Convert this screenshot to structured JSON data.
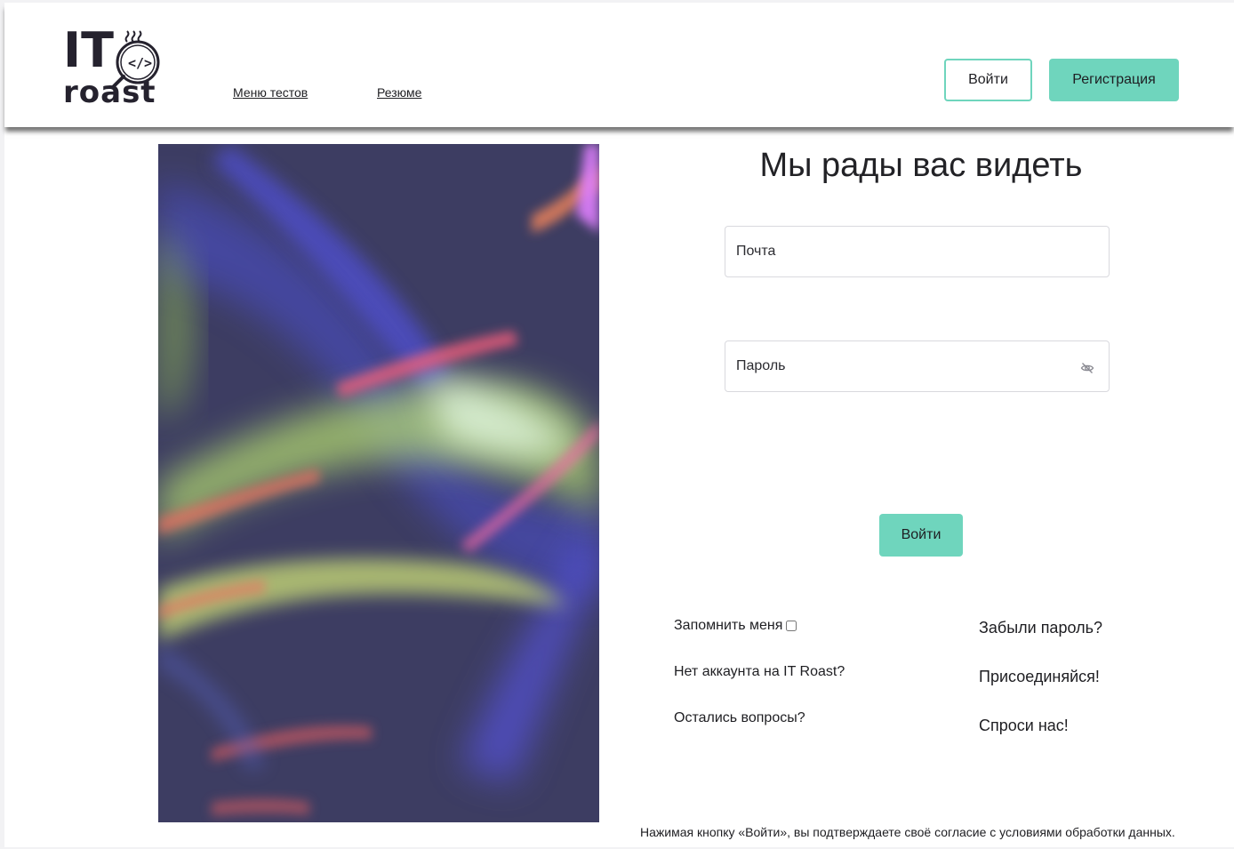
{
  "header": {
    "logo_text": "IT roast",
    "nav": [
      {
        "label": "Меню тестов"
      },
      {
        "label": "Резюме"
      }
    ],
    "login_label": "Войти",
    "register_label": "Регистрация"
  },
  "login": {
    "title": "Мы рады вас видеть",
    "email_placeholder": "Почта",
    "password_placeholder": "Пароль",
    "submit_label": "Войти",
    "remember_label": "Запомнить меня",
    "remember_checked": false,
    "forgot_label": "Забыли пароль?",
    "no_account_label": "Нет аккаунта на IT Roast?",
    "join_label": "Присоединяйся!",
    "questions_label": "Остались вопросы?",
    "ask_label": "Спроси нас!",
    "consent_text": "Нажимая кнопку «Войти», вы подтверждаете своё согласие с условиями обработки данных."
  },
  "colors": {
    "accent": "#6fd5bd",
    "text": "#1e1e22",
    "art_background": "#3d3d62"
  },
  "icons": {
    "password_toggle": "eye-slash-icon",
    "logo_mark": "magnifier-code-icon"
  }
}
